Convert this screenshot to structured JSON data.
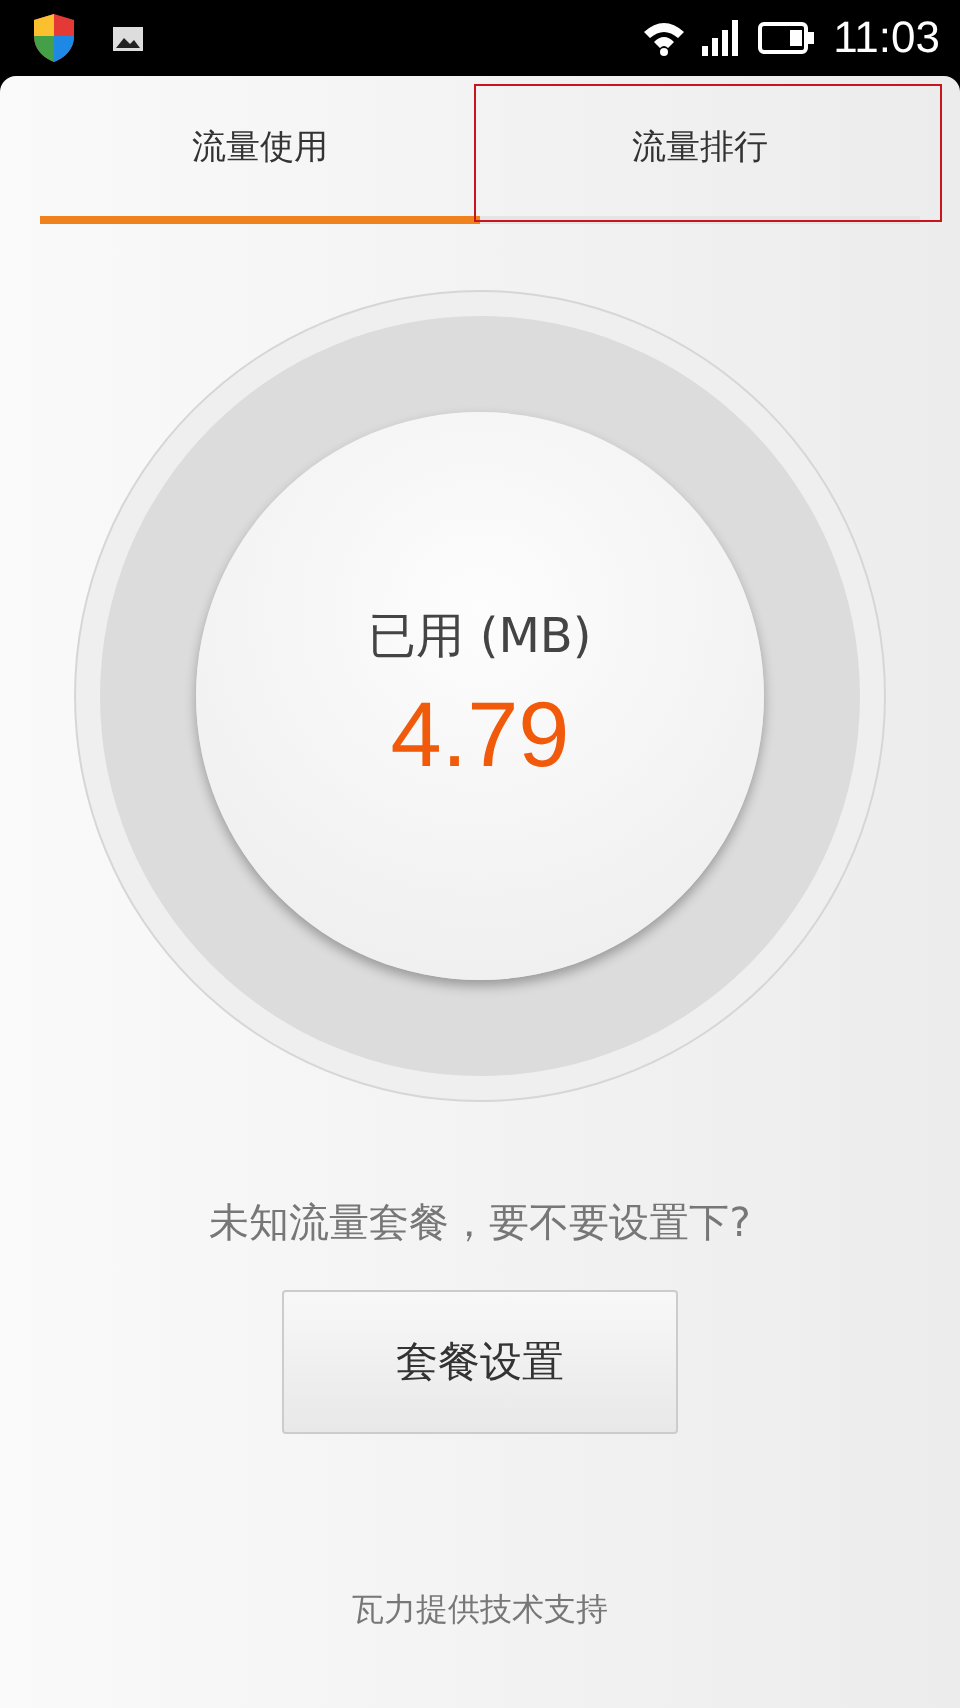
{
  "status_bar": {
    "time": "11:03"
  },
  "tabs": [
    {
      "label": "流量使用",
      "selected": true
    },
    {
      "label": "流量排行",
      "selected": false
    }
  ],
  "usage": {
    "label": "已用 (MB)",
    "value": "4.79"
  },
  "prompt": "未知流量套餐，要不要设置下?",
  "button": "套餐设置",
  "footer": "瓦力提供技术支持"
}
